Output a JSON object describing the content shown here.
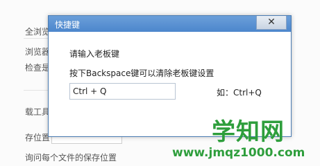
{
  "background": {
    "texts": [
      "全浏览",
      "浏览器",
      "检查是",
      "载工具",
      "存位置",
      "询问每个文件的保存位置"
    ]
  },
  "dialog": {
    "title": "快捷键",
    "close_label": "✕",
    "prompt": "请输入老板键",
    "hint": "按下Backspace键可以清除老板键设置",
    "key_value": "Ctrl + Q",
    "example": "如：Ctrl+Q"
  },
  "watermark": {
    "title": "学知网",
    "url": "www.jmqz1000.com"
  },
  "colors": {
    "titlebar": "#4c86cc",
    "watermark": "#2e9e3c"
  }
}
